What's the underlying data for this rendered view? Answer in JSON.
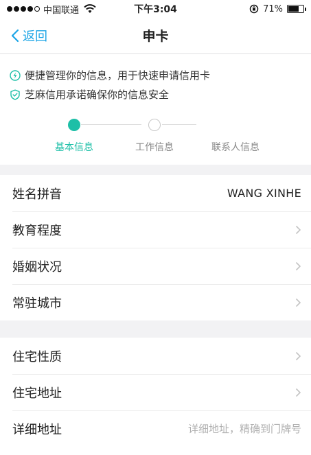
{
  "status_bar": {
    "carrier": "中国联通",
    "time": "下午3:04",
    "battery_percent": "71%",
    "battery_level": 0.71
  },
  "nav": {
    "back_label": "返回",
    "title": "申卡"
  },
  "notices": [
    "便捷管理你的信息，用于快速申请信用卡",
    "芝麻信用承诺确保你的信息安全"
  ],
  "steps": [
    {
      "label": "基本信息",
      "active": true
    },
    {
      "label": "工作信息",
      "active": false
    },
    {
      "label": "联系人信息",
      "active": false
    }
  ],
  "sections": [
    {
      "rows": [
        {
          "label": "姓名拼音",
          "value": "WANG XINHE"
        },
        {
          "label": "教育程度"
        },
        {
          "label": "婚姻状况"
        },
        {
          "label": "常驻城市"
        }
      ]
    },
    {
      "rows": [
        {
          "label": "住宅性质"
        },
        {
          "label": "住宅地址"
        },
        {
          "label": "详细地址",
          "placeholder": "详细地址，精确到门牌号"
        }
      ]
    }
  ],
  "colors": {
    "accent_blue": "#1aa4e6",
    "accent_green": "#1dbfa7"
  }
}
